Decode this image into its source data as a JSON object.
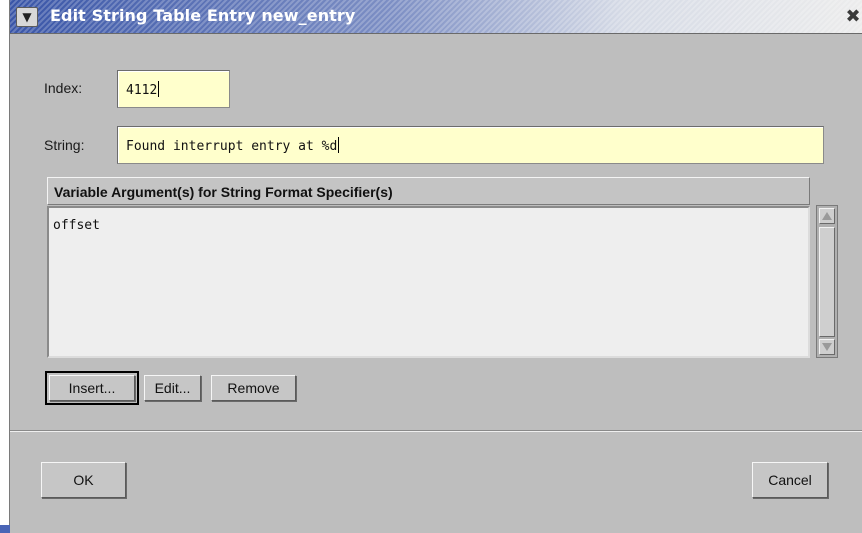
{
  "window": {
    "title": "Edit String Table Entry new_entry",
    "menu_icon": "chevron-down-icon",
    "close_icon": "close-icon"
  },
  "form": {
    "index_label": "Index:",
    "index_value": "4112",
    "string_label": "String:",
    "string_value": "Found interrupt entry at %d"
  },
  "arguments": {
    "header": "Variable Argument(s) for String Format Specifier(s)",
    "items": [
      "offset"
    ]
  },
  "buttons": {
    "insert": "Insert...",
    "edit": "Edit...",
    "remove": "Remove",
    "ok": "OK",
    "cancel": "Cancel"
  },
  "colors": {
    "field_background": "#ffffcc",
    "titlebar_accent": "#3a56a8",
    "window_background": "#bebebe"
  }
}
